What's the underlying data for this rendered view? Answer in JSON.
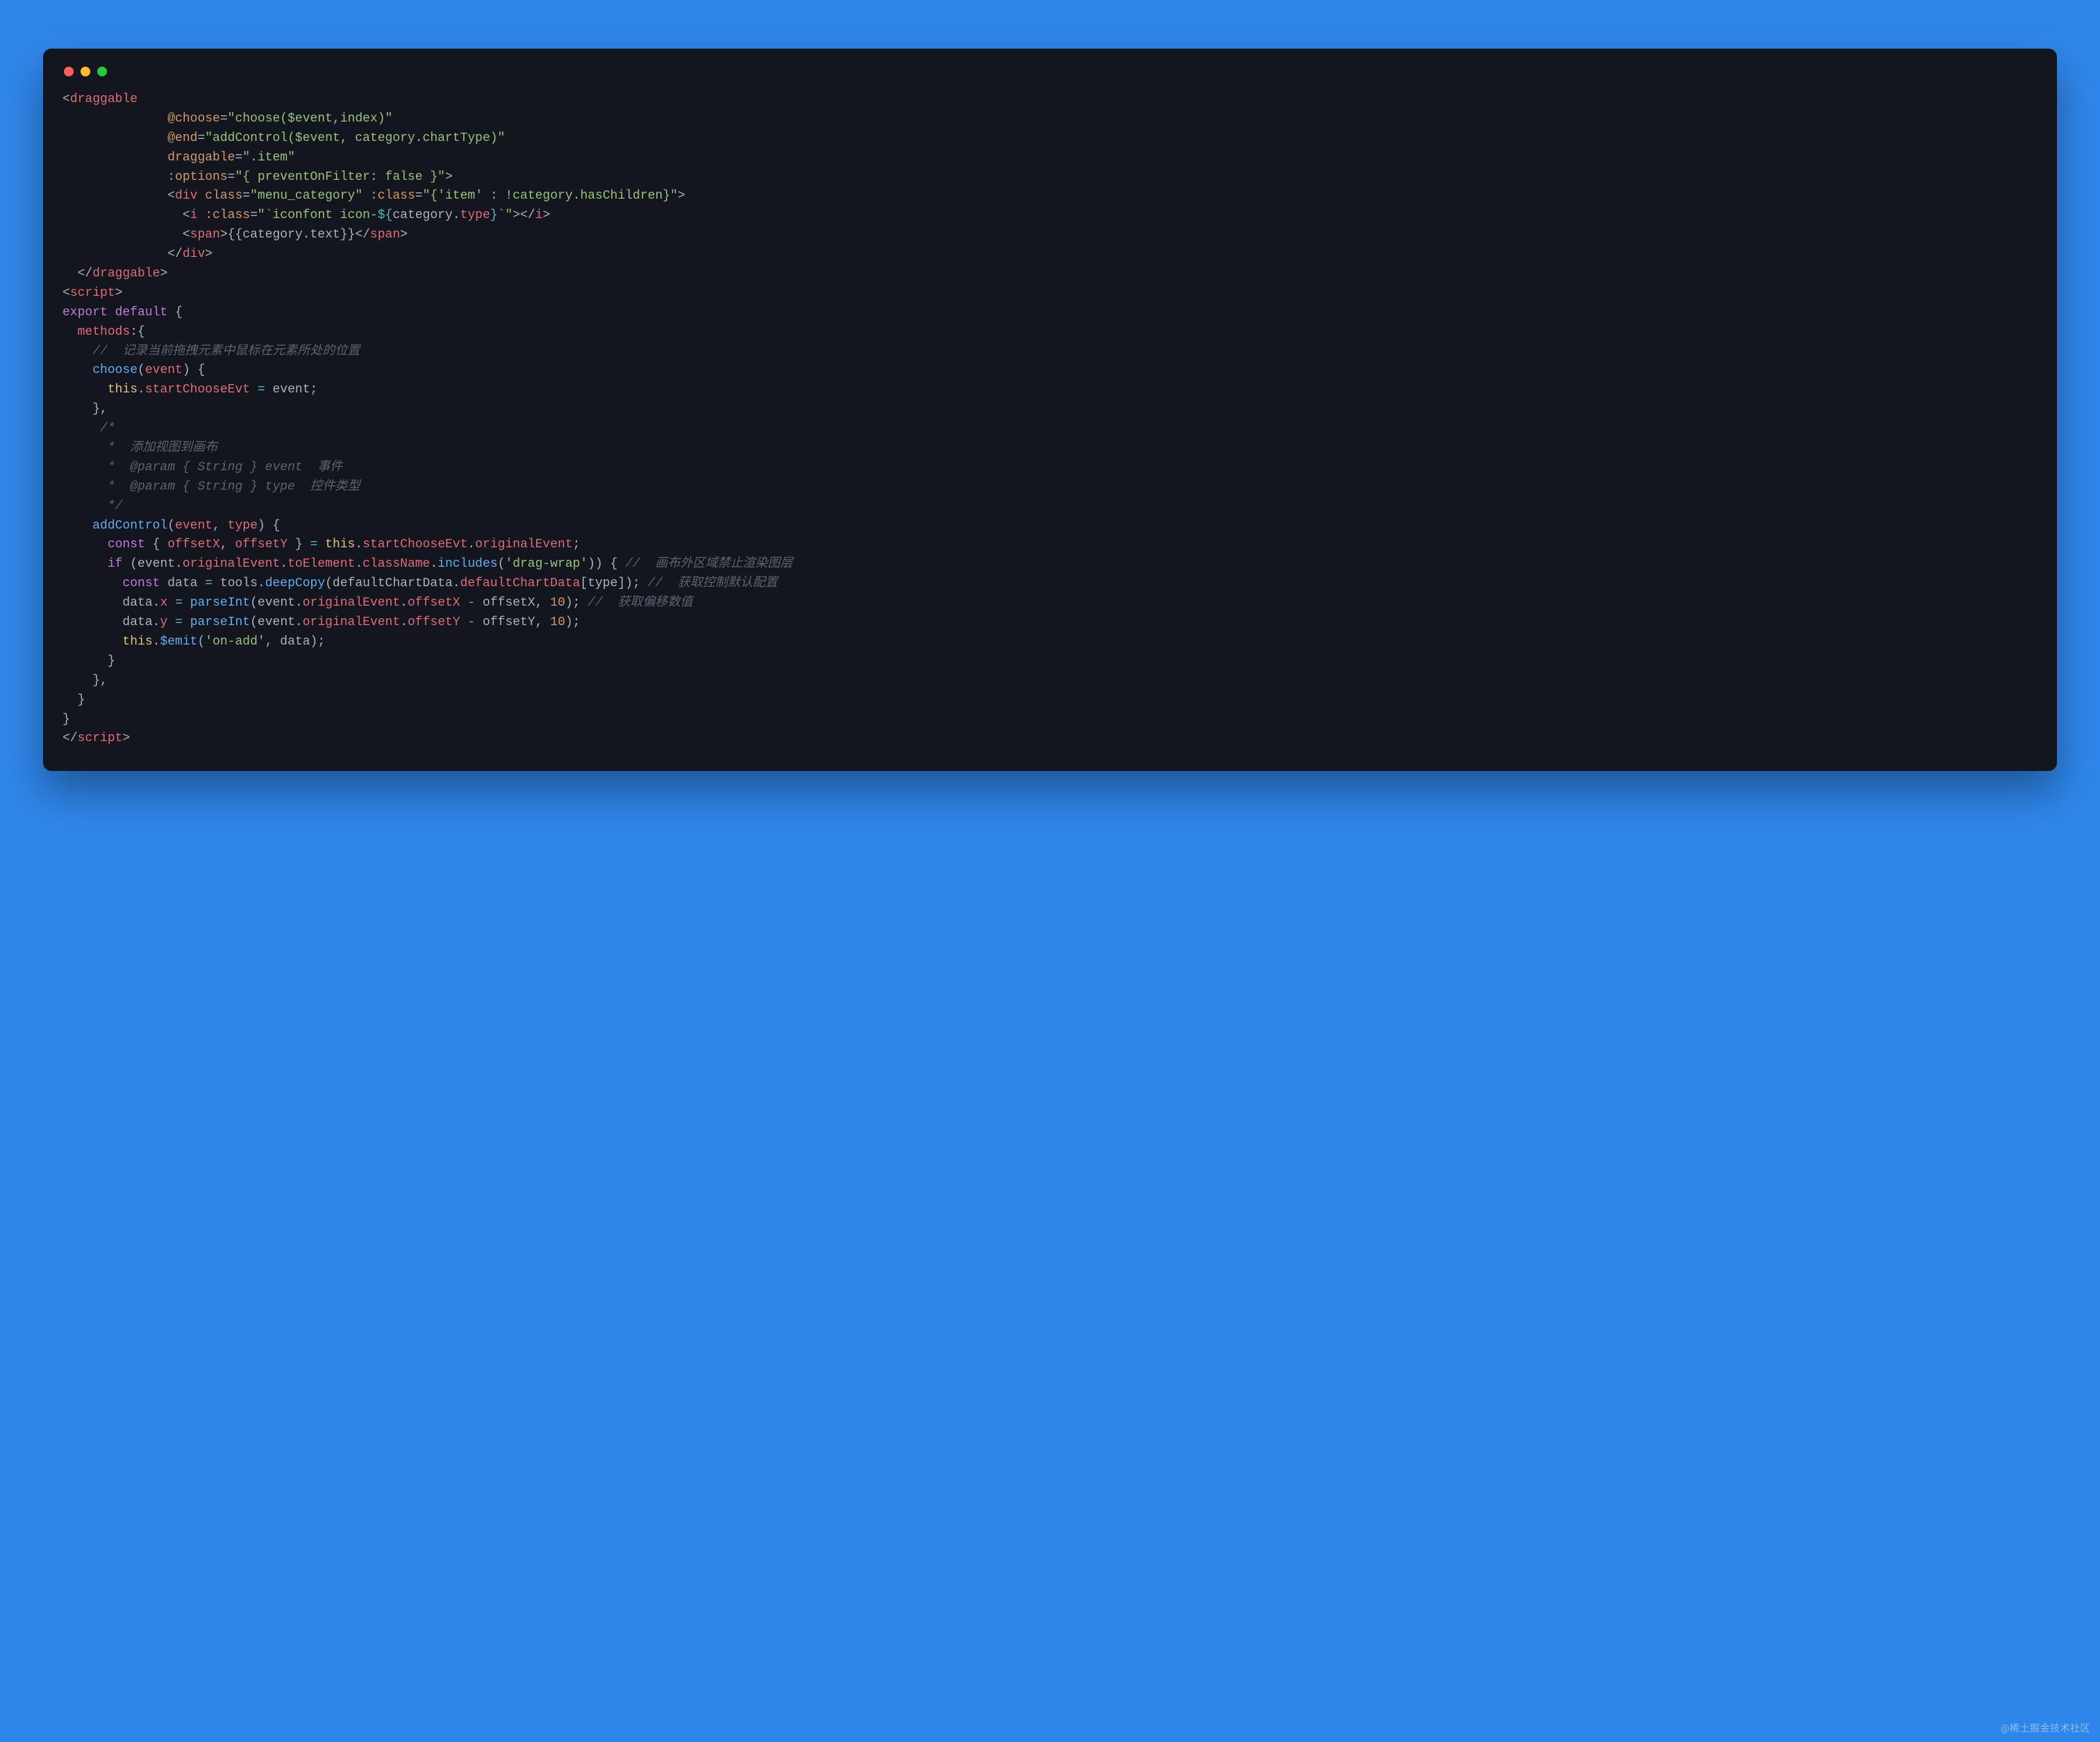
{
  "watermark": "@稀土掘金技术社区",
  "traffic_light_colors": {
    "red": "#ff5f56",
    "yellow": "#ffbd2e",
    "green": "#27c93f"
  },
  "code": {
    "language": "vue",
    "template": {
      "component": "draggable",
      "attributes": {
        "@choose": "choose($event,index)",
        "@end": "addControl($event, category.chartType)",
        "draggable": ".item",
        ":options": "{ preventOnFilter: false }"
      },
      "child_div": {
        "class": "menu_category",
        "class_binding": "{'item' : !category.hasChildren}",
        "icon_class_binding": "`iconfont icon-${category.type}`",
        "span_expression": "{{category.text}}"
      }
    },
    "script": {
      "export_default": true,
      "methods": {
        "choose": {
          "comment": "记录当前拖拽元素中鼠标在元素所处的位置",
          "params": [
            "event"
          ],
          "body": "this.startChooseEvt = event;"
        },
        "addControl": {
          "doc": {
            "summary": "添加视图到画布",
            "params": [
              {
                "name": "event",
                "type": "String",
                "desc": "事件"
              },
              {
                "name": "type",
                "type": "String",
                "desc": "控件类型"
              }
            ]
          },
          "params": [
            "event",
            "type"
          ],
          "body_lines": [
            "const { offsetX, offsetY } = this.startChooseEvt.originalEvent;",
            "if (event.originalEvent.toElement.className.includes('drag-wrap')) { //  画布外区域禁止渲染图层",
            "  const data = tools.deepCopy(defaultChartData.defaultChartData[type]); //  获取控制默认配置",
            "  data.x = parseInt(event.originalEvent.offsetX - offsetX, 10); //  获取偏移数值",
            "  data.y = parseInt(event.originalEvent.offsetY - offsetY, 10);",
            "  this.$emit('on-add', data);",
            "}"
          ]
        }
      }
    },
    "raw_lines": [
      "<draggable",
      "              @choose=\"choose($event,index)\"",
      "              @end=\"addControl($event, category.chartType)\"",
      "              draggable=\".item\"",
      "              :options=\"{ preventOnFilter: false }\">",
      "              <div class=\"menu_category\" :class=\"{'item' : !category.hasChildren}\">",
      "                <i :class=\"`iconfont icon-${category.type}`\"></i>",
      "                <span>{{category.text}}</span>",
      "              </div>",
      "  </draggable>",
      "<script>",
      "export default {",
      "  methods:{",
      "    //  记录当前拖拽元素中鼠标在元素所处的位置",
      "    choose(event) {",
      "      this.startChooseEvt = event;",
      "    },",
      "     /*",
      "      *  添加视图到画布",
      "      *  @param { String } event  事件",
      "      *  @param { String } type  控件类型",
      "      */",
      "    addControl(event, type) {",
      "      const { offsetX, offsetY } = this.startChooseEvt.originalEvent;",
      "      if (event.originalEvent.toElement.className.includes('drag-wrap')) { //  画布外区域禁止渲染图层",
      "        const data = tools.deepCopy(defaultChartData.defaultChartData[type]); //  获取控制默认配置",
      "        data.x = parseInt(event.originalEvent.offsetX - offsetX, 10); //  获取偏移数值",
      "        data.y = parseInt(event.originalEvent.offsetY - offsetY, 10);",
      "        this.$emit('on-add', data);",
      "      }",
      "    },",
      "  }",
      "}",
      "</script>"
    ]
  }
}
